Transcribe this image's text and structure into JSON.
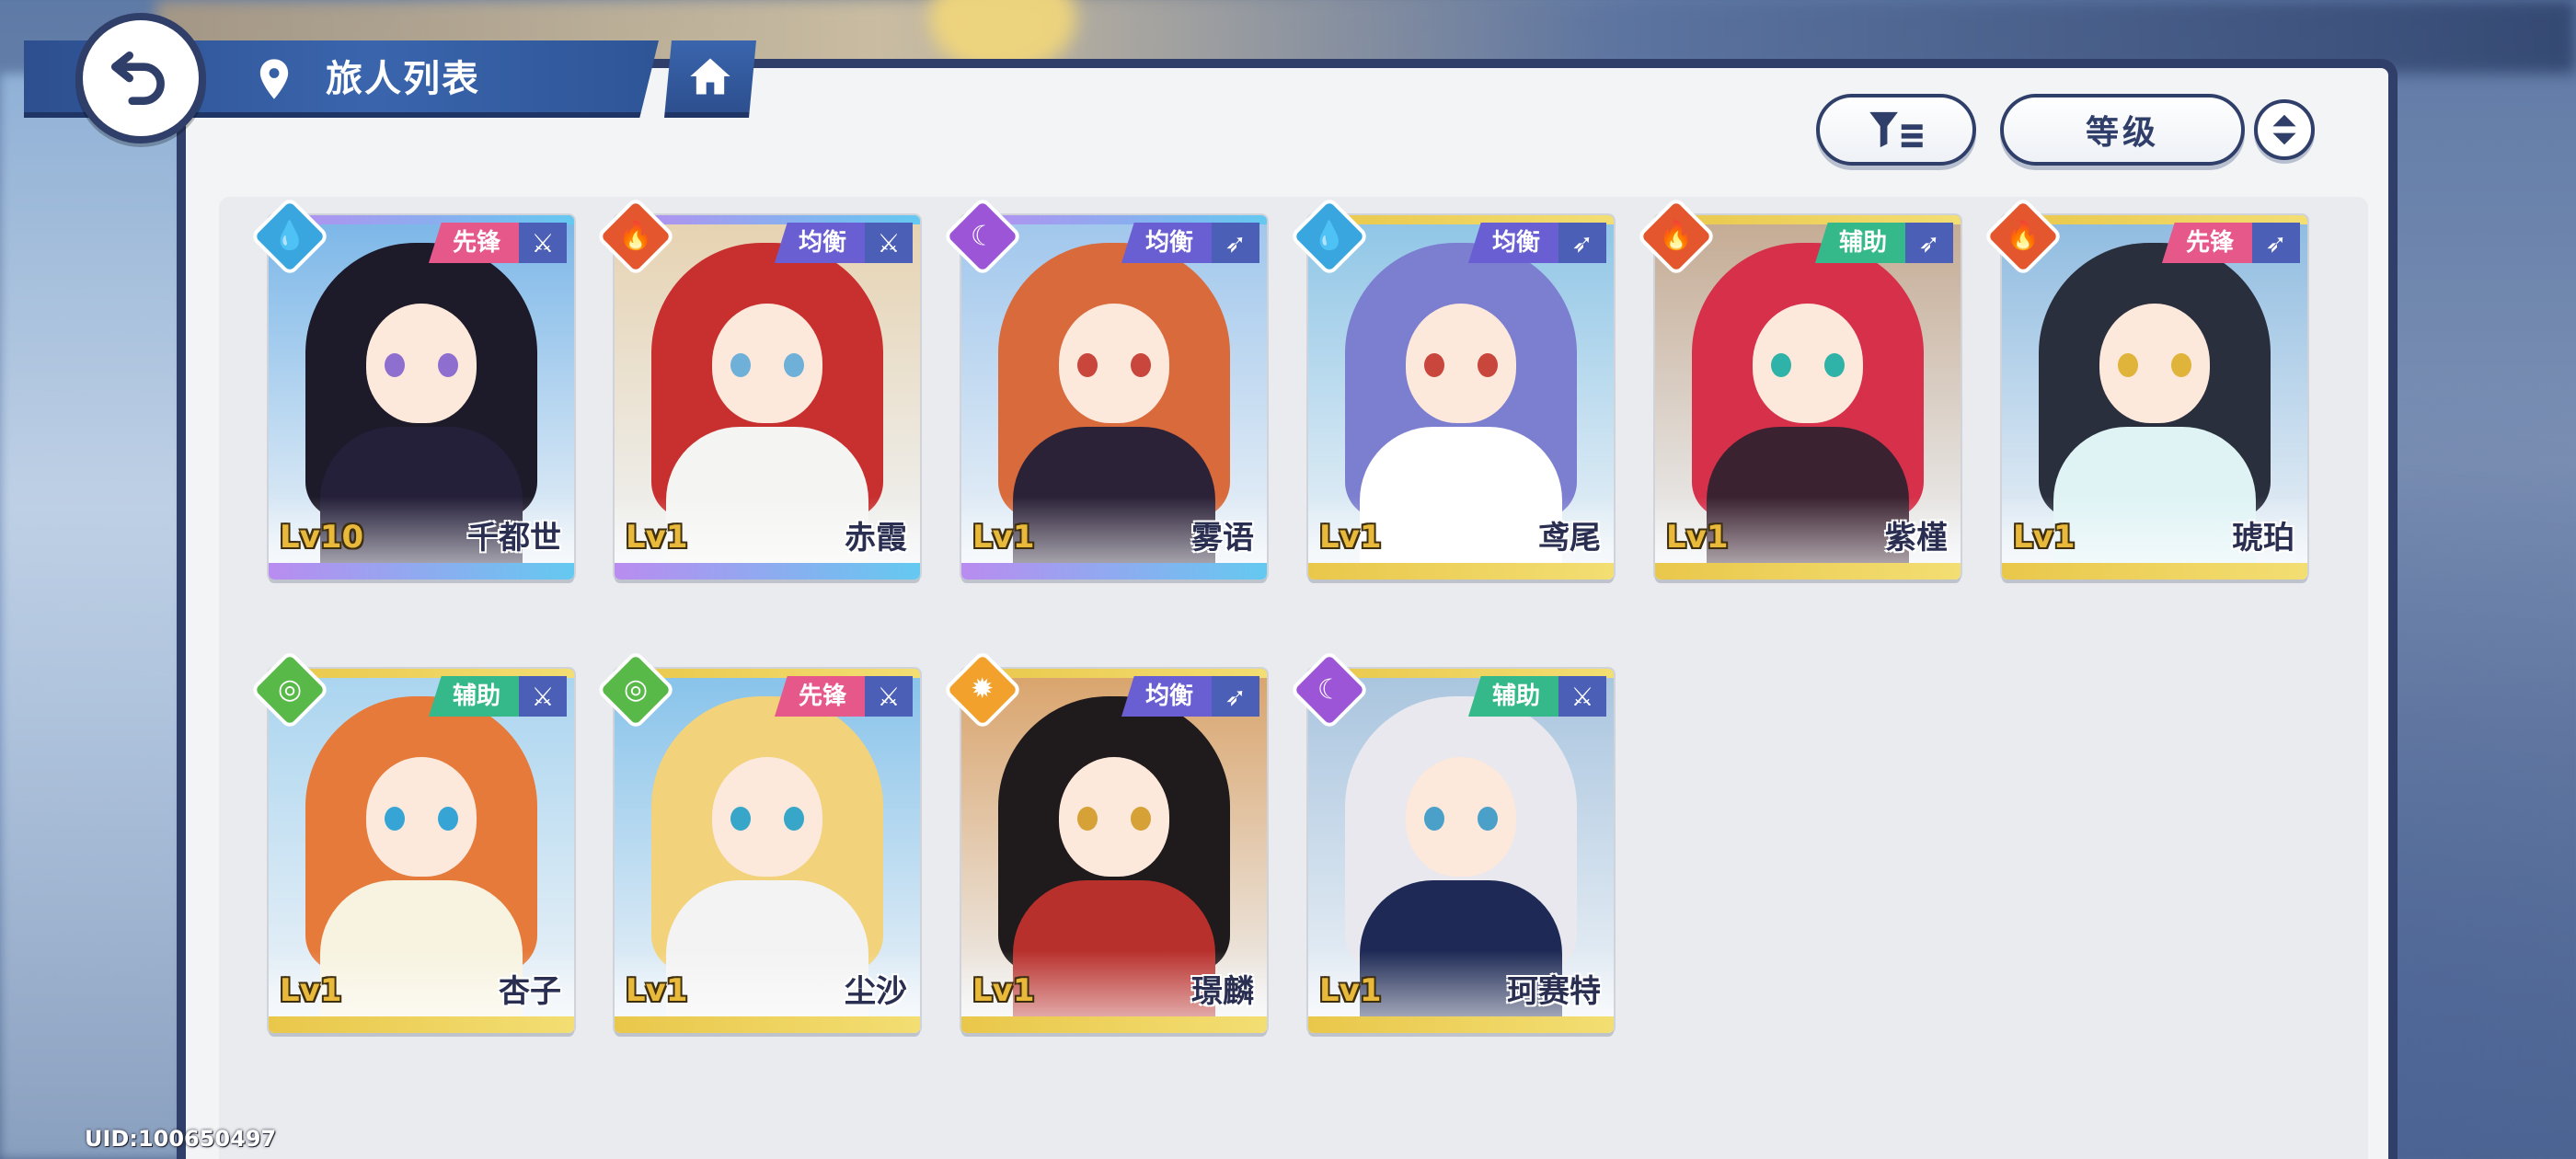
{
  "header": {
    "title": "旅人列表"
  },
  "controls": {
    "sort_label": "等级"
  },
  "uid": "UID:100650497",
  "colors": {
    "panel_border": "#2f3f69",
    "header_blue": "#3a65ad",
    "level_gold": "#e8b93a",
    "water": "#3aa6e0",
    "fire": "#e4572e",
    "moon": "#9b55d6",
    "wind": "#58b948",
    "light": "#f2a22c",
    "role_vanguard": "#e6588a",
    "role_balance": "#6a5fd2",
    "role_support": "#35b98a"
  },
  "characters": [
    {
      "name": "千都世",
      "level": "Lv10",
      "role": "先锋",
      "element": "water",
      "weapon": "sword-icon"
    },
    {
      "name": "赤霞",
      "level": "Lv1",
      "role": "均衡",
      "element": "fire",
      "weapon": "sword-icon"
    },
    {
      "name": "雾语",
      "level": "Lv1",
      "role": "均衡",
      "element": "moon",
      "weapon": "bow-icon"
    },
    {
      "name": "鸢尾",
      "level": "Lv1",
      "role": "均衡",
      "element": "water",
      "weapon": "bow-icon"
    },
    {
      "name": "紫槿",
      "level": "Lv1",
      "role": "辅助",
      "element": "fire",
      "weapon": "bow-icon"
    },
    {
      "name": "琥珀",
      "level": "Lv1",
      "role": "先锋",
      "element": "fire",
      "weapon": "bow-icon"
    },
    {
      "name": "杏子",
      "level": "Lv1",
      "role": "辅助",
      "element": "wind",
      "weapon": "sword-icon"
    },
    {
      "name": "尘沙",
      "level": "Lv1",
      "role": "先锋",
      "element": "wind",
      "weapon": "sword-icon"
    },
    {
      "name": "璟麟",
      "level": "Lv1",
      "role": "均衡",
      "element": "light",
      "weapon": "bow-icon"
    },
    {
      "name": "珂赛特",
      "level": "Lv1",
      "role": "辅助",
      "element": "moon",
      "weapon": "sword-icon"
    }
  ]
}
